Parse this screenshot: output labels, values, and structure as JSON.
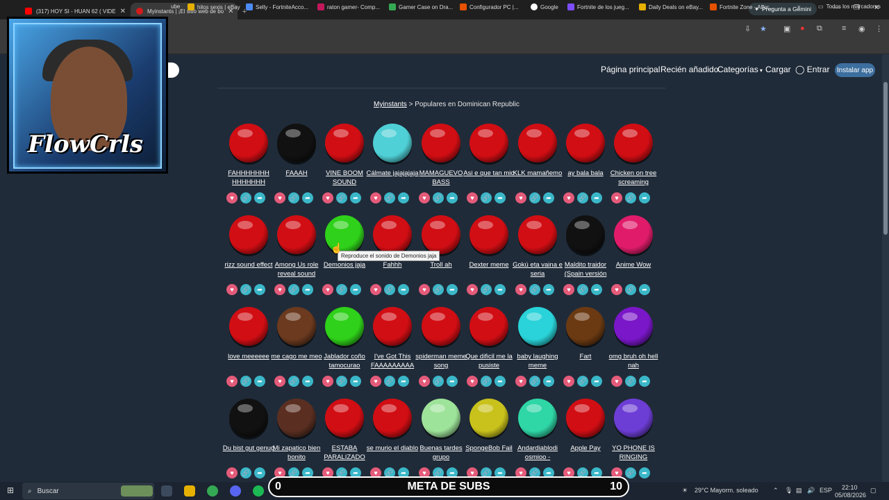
{
  "tabs": [
    {
      "title": "(317) HOY SI - HUAN 62 ( VIDE",
      "color": "#ff0000"
    },
    {
      "title": "Myinstants | ¡El sitio web de bo",
      "color": "#d21b1b"
    }
  ],
  "gemini": "Pregunta a Gemini",
  "bookmarks": [
    "ube",
    "hilos sexis | eBay",
    "Selly - FortniteAcco...",
    "raton gamer- Comp...",
    "Gamer Case on Dra...",
    "Configurador PC |...",
    "Google",
    "Fortnite de los jueg...",
    "Daily Deals on eBay...",
    "Fortnite Zone - Affor...",
    "Todos los marcadores"
  ],
  "nav": {
    "home": "Página principal",
    "recent": "Recién añadido",
    "categories": "Categorías",
    "upload": "Cargar",
    "login": "Entrar",
    "install": "Instalar app"
  },
  "breadcrumb": {
    "link": "Myinstants",
    "rest": "> Populares en Dominican Republic"
  },
  "sounds": [
    {
      "label": "FAHHHHHHH HHHHHHH",
      "color": "#d10e14"
    },
    {
      "label": "FAAAH",
      "color": "#111111"
    },
    {
      "label": "VINE BOOM SOUND",
      "color": "#d10e14"
    },
    {
      "label": "Cálmate jajajajaja",
      "color": "#4fd0d6"
    },
    {
      "label": "MAMAGUEVO BASS",
      "color": "#d10e14"
    },
    {
      "label": "Asi e que tan mio",
      "color": "#d10e14"
    },
    {
      "label": "KLK mamañemo",
      "color": "#d10e14"
    },
    {
      "label": "ay bala bala",
      "color": "#d10e14"
    },
    {
      "label": "Chicken on tree screaming",
      "color": "#d10e14"
    },
    {
      "label": "rizz sound effect",
      "color": "#d10e14"
    },
    {
      "label": "Among Us role reveal sound",
      "color": "#d10e14"
    },
    {
      "label": "Demonios jaja",
      "color": "#2fd11a"
    },
    {
      "label": "Fahhh",
      "color": "#d10e14"
    },
    {
      "label": "Troll ah",
      "color": "#d10e14"
    },
    {
      "label": "Dexter meme",
      "color": "#d10e14"
    },
    {
      "label": "Gokú eta vaina e seria",
      "color": "#d10e14"
    },
    {
      "label": "Maldito traidor (Spain versión",
      "color": "#111111"
    },
    {
      "label": "Anime Wow",
      "color": "#e01c6a"
    },
    {
      "label": "love meeeeee",
      "color": "#d10e14"
    },
    {
      "label": "me cago me meo",
      "color": "#6b3a1f"
    },
    {
      "label": "Jablador coño tamocurao",
      "color": "#2fd11a"
    },
    {
      "label": "I've Got This FAAAAAAAAA",
      "color": "#d10e14"
    },
    {
      "label": "spiderman meme song",
      "color": "#d10e14"
    },
    {
      "label": "Que dificil me la pusiste",
      "color": "#d10e14"
    },
    {
      "label": "baby laughing meme",
      "color": "#29d3d9"
    },
    {
      "label": "Fart",
      "color": "#6b3a12"
    },
    {
      "label": "omg bruh oh hell nah",
      "color": "#7a17c9"
    },
    {
      "label": "Du bist gut genug",
      "color": "#111111"
    },
    {
      "label": "Mi zapatico bien bonito",
      "color": "#5a2f22"
    },
    {
      "label": "ESTABA PARALIZADO",
      "color": "#d10e14"
    },
    {
      "label": "se murio el diablo",
      "color": "#d10e14"
    },
    {
      "label": "Buenas tardes grupo",
      "color": "#9ee39a"
    },
    {
      "label": "SpongeBob Fail",
      "color": "#c9c21c"
    },
    {
      "label": "Andardiablodi osmioo -",
      "color": "#2fd6a6"
    },
    {
      "label": "Apple Pay",
      "color": "#d10e14"
    },
    {
      "label": "YO PHONE IS RINGING",
      "color": "#6d3ed6"
    }
  ],
  "tooltip": "Reproduce el sonido de Demonios jaja",
  "overlay": {
    "logo": "FlowCrls",
    "subs_title": "META DE SUBS",
    "subs_left": "0",
    "subs_right": "10"
  },
  "taskbar": {
    "search": "Buscar",
    "weather": "29°C  Mayorm. soleado",
    "lang": "ESP",
    "time": "22:10",
    "date": "05/08/2026"
  }
}
